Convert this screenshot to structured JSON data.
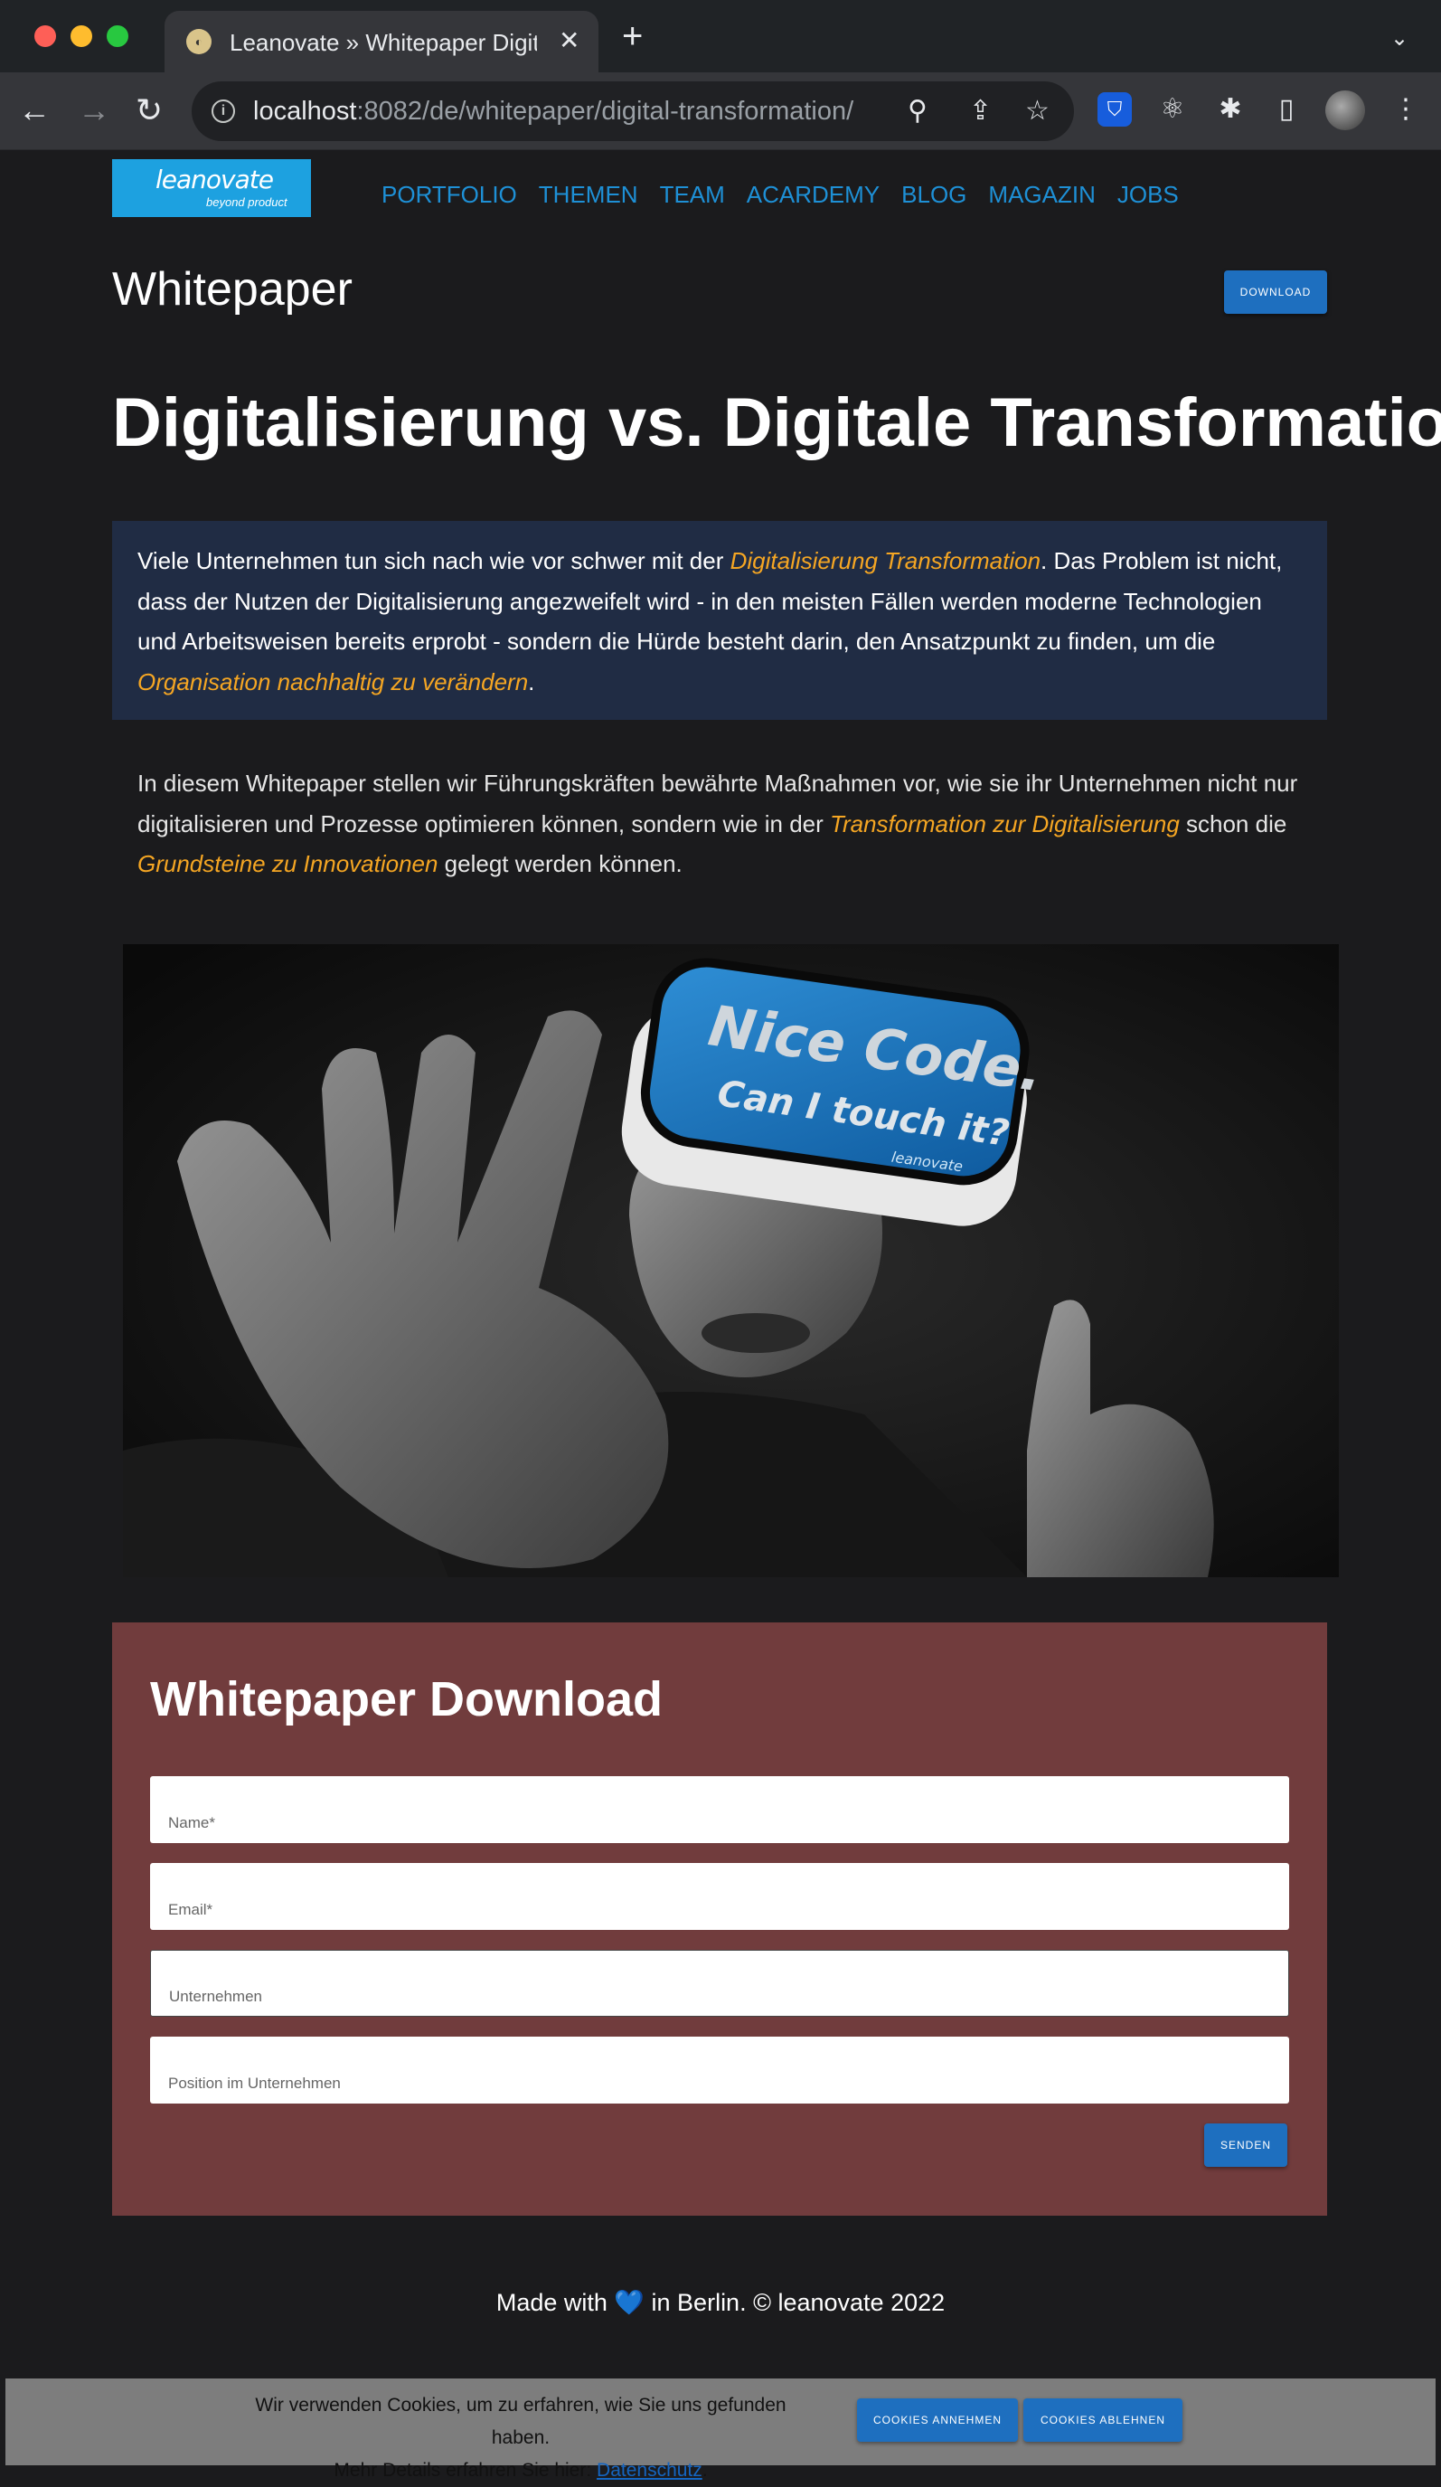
{
  "browser": {
    "tab_title": "Leanovate » Whitepaper Digitalisierung",
    "tab_close": "✕",
    "new_tab": "+",
    "url_host": "localhost",
    "url_path": ":8082/de/whitepaper/digital-transformation/"
  },
  "site": {
    "logo_main": "leanovate",
    "logo_sub": "beyond product",
    "nav": [
      "PORTFOLIO",
      "THEMEN",
      "TEAM",
      "ACARDEMY",
      "BLOG",
      "MAGAZIN",
      "JOBS"
    ]
  },
  "header": {
    "title": "Whitepaper",
    "download_label": "DOWNLOAD"
  },
  "headline": "Digitalisierung vs. Digitale Transformation",
  "intro": {
    "t1": "Viele Unternehmen tun sich nach wie vor schwer mit der ",
    "h1": "Digitalisierung Transformation",
    "t2": ". Das Problem ist nicht, dass der Nutzen der Digitalisierung angezweifelt wird - in den meisten Fällen werden moderne Technologien und Arbeitsweisen bereits erprobt - sondern die Hürde besteht darin, den Ansatzpunkt zu finden, um die ",
    "h2": "Organisation nachhaltig zu verändern",
    "t3": "."
  },
  "body": {
    "t1": "In diesem Whitepaper stellen wir Führungskräften bewährte Maßnahmen vor, wie sie ihr Unternehmen nicht nur digitalisieren und Prozesse optimieren können, sondern wie in der ",
    "h1": "Transformation zur Digitalisierung",
    "t2": " schon die ",
    "h2": "Grundsteine zu Innovationen",
    "t3": " gelegt werden können."
  },
  "hero": {
    "headset_line1": "Nice Code.",
    "headset_line2": "Can I touch it?",
    "headset_brand": "leanovate"
  },
  "form": {
    "title": "Whitepaper Download",
    "name_placeholder": "Name*",
    "email_placeholder": "Email*",
    "company_placeholder": "Unternehmen",
    "position_placeholder": "Position im Unternehmen",
    "submit_label": "SENDEN"
  },
  "footer": {
    "before": "Made with ",
    "heart": "💙",
    "after": " in Berlin. © leanovate 2022"
  },
  "cookie": {
    "line1": "Wir verwenden Cookies, um zu erfahren, wie Sie uns gefunden haben.",
    "line2_prefix": "Mehr Details erfahren Sie hier: ",
    "link": "Datenschutz",
    "line2_suffix": ".",
    "accept_label": "COOKIES ANNEHMEN",
    "decline_label": "COOKIES ABLEHNEN"
  },
  "colors": {
    "accent_blue": "#1e6fbf",
    "nav_blue": "#1e90d6",
    "highlight_orange": "#f5a623",
    "intro_bg": "#202c44",
    "form_bg": "#713c3d"
  },
  "icons": {
    "back": "arrow-left-icon",
    "forward": "arrow-right-icon",
    "reload": "reload-icon",
    "info": "info-icon",
    "zoom": "zoom-icon",
    "share": "share-icon",
    "bookmark": "star-icon",
    "extensions": "puzzle-icon",
    "menu": "kebab-menu-icon"
  }
}
